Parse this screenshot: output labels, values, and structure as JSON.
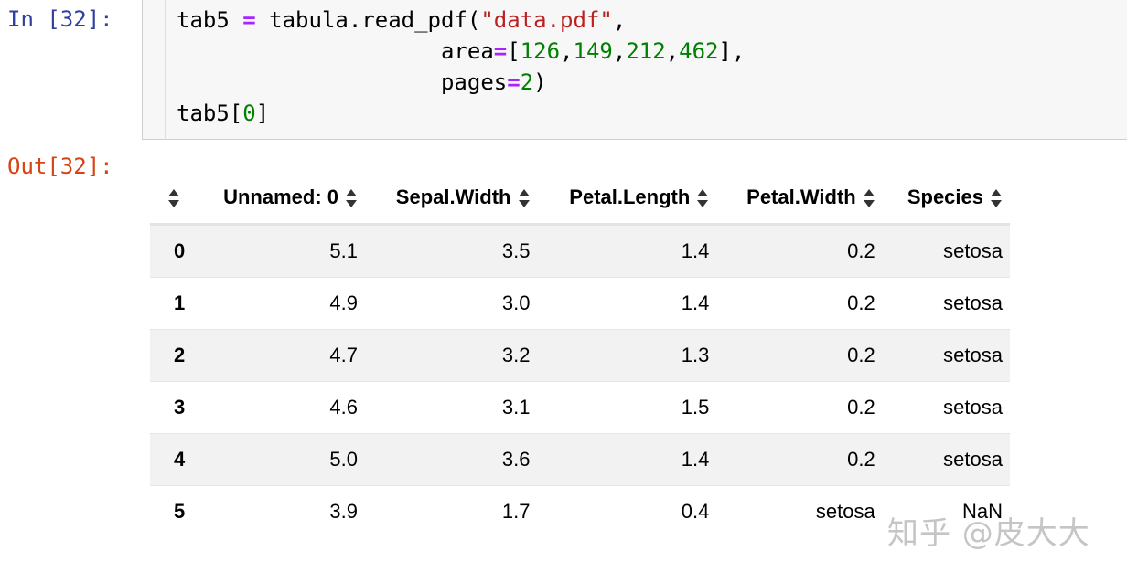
{
  "input_prompt": "In [32]:",
  "output_prompt": "Out[32]:",
  "code": {
    "l1_var": "tab5 ",
    "l1_eq": "=",
    "l1_call": " tabula.read_pdf(",
    "l1_str": "\"data.pdf\"",
    "l1_comma": ",",
    "l2_indent": "                    area",
    "l2_eq": "=",
    "l2_open": "[",
    "l2_n1": "126",
    "l2_c1": ",",
    "l2_n2": "149",
    "l2_c2": ",",
    "l2_n3": "212",
    "l2_c3": ",",
    "l2_n4": "462",
    "l2_close": "],",
    "l3_indent": "                    pages",
    "l3_eq": "=",
    "l3_num": "2",
    "l3_close": ")",
    "l4_pre": "tab5[",
    "l4_num": "0",
    "l4_post": "]"
  },
  "table": {
    "columns": [
      "Unnamed: 0",
      "Sepal.Width",
      "Petal.Length",
      "Petal.Width",
      "Species"
    ],
    "rows": [
      {
        "index": "0",
        "cells": [
          "5.1",
          "3.5",
          "1.4",
          "0.2",
          "setosa"
        ]
      },
      {
        "index": "1",
        "cells": [
          "4.9",
          "3.0",
          "1.4",
          "0.2",
          "setosa"
        ]
      },
      {
        "index": "2",
        "cells": [
          "4.7",
          "3.2",
          "1.3",
          "0.2",
          "setosa"
        ]
      },
      {
        "index": "3",
        "cells": [
          "4.6",
          "3.1",
          "1.5",
          "0.2",
          "setosa"
        ]
      },
      {
        "index": "4",
        "cells": [
          "5.0",
          "3.6",
          "1.4",
          "0.2",
          "setosa"
        ]
      },
      {
        "index": "5",
        "cells": [
          "3.9",
          "1.7",
          "0.4",
          "setosa",
          "NaN"
        ]
      }
    ]
  },
  "watermark": "知乎 @皮大大"
}
